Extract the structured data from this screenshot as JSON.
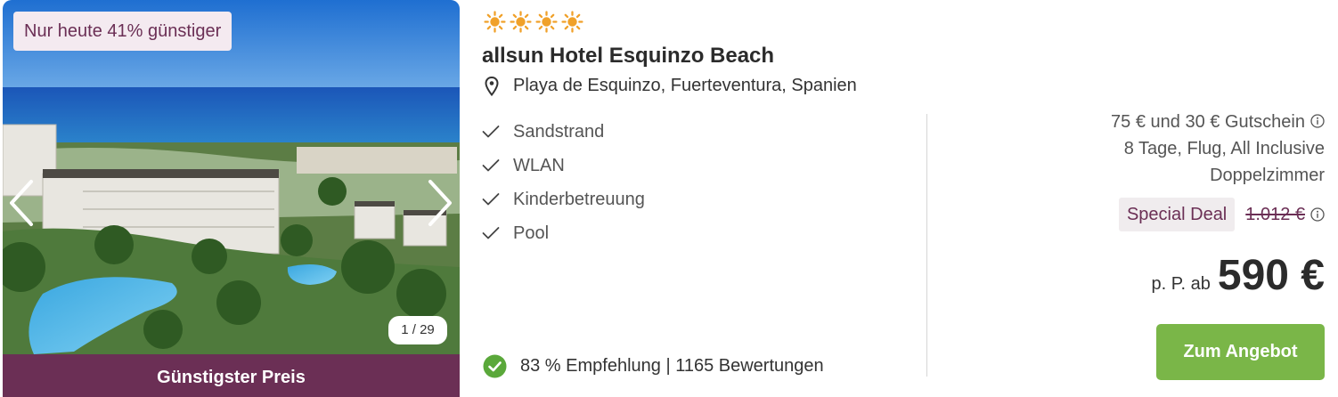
{
  "gallery": {
    "badge": "Nur heute 41% günstiger",
    "counter": "1 / 29",
    "footer_label": "Günstigster Preis"
  },
  "hotel": {
    "stars": 4,
    "name": "allsun Hotel Esquinzo Beach",
    "location": "Playa de Esquinzo, Fuerteventura, Spanien",
    "features": [
      "Sandstrand",
      "WLAN",
      "Kinderbetreuung",
      "Pool"
    ],
    "rating_text": "83 % Empfehlung | 1165 Bewertungen"
  },
  "offer": {
    "voucher": "75 € und 30 € Gutschein",
    "details": "8 Tage, Flug, All Inclusive",
    "room": "Doppelzimmer",
    "deal_label": "Special Deal",
    "old_price": "1.012 €",
    "price_prefix": "p. P. ab",
    "price": "590 €",
    "cta_label": "Zum Angebot"
  },
  "colors": {
    "accent_purple": "#6b2f55",
    "badge_bg": "#f4eaf0",
    "cta_green": "#7ab648",
    "star_orange": "#f0a12a",
    "check_green": "#5aa83a"
  }
}
